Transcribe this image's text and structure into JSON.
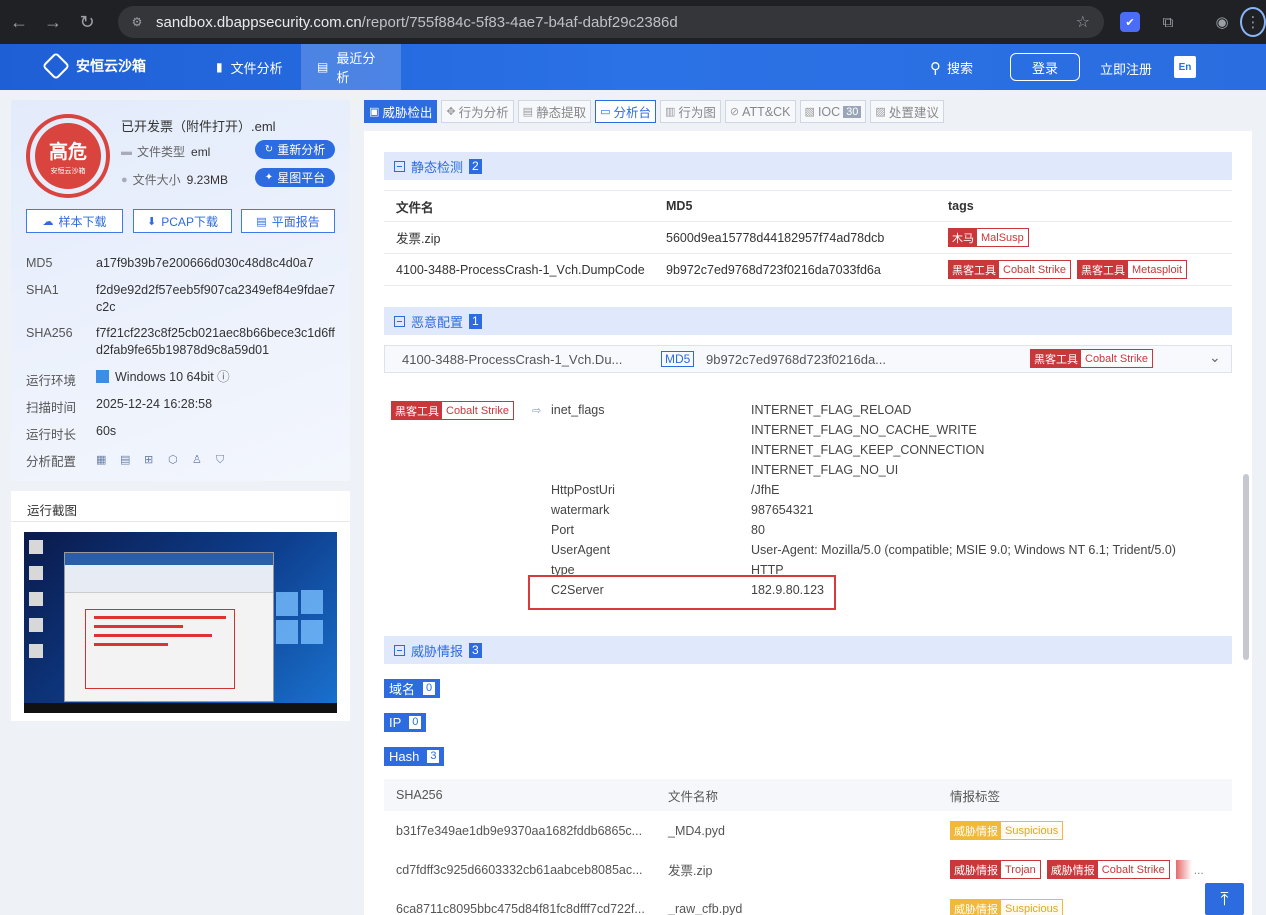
{
  "browser": {
    "url_host": "sandbox.dbappsecurity.com.cn",
    "url_path": "/report/755f884c-5f83-4ae7-b4af-dabf29c2386d"
  },
  "header": {
    "brand": "安恒云沙箱",
    "nav": [
      "文件分析",
      "最近分析"
    ],
    "search": "搜索",
    "login": "登录",
    "register": "立即注册",
    "lang": "En"
  },
  "file": {
    "risk": "高危",
    "seal_sub": "安恒云沙箱",
    "name": "已开发票（附件打开）.eml",
    "type_label": "文件类型",
    "type_value": "eml",
    "size_label": "文件大小",
    "size_value": "9.23MB",
    "reanalyze": "重新分析",
    "xingtu": "星图平台",
    "buttons": [
      "样本下载",
      "PCAP下载",
      "平面报告"
    ],
    "md5_label": "MD5",
    "md5": "a17f9b39b7e200666d030c48d8c4d0a7",
    "sha1_label": "SHA1",
    "sha1": "f2d9e92d2f57eeb5f907ca2349ef84e9fdae7c2c",
    "sha256_label": "SHA256",
    "sha256": "f7f21cf223c8f25cb021aec8b66bece3c1d6ffd2fab9fe65b19878d9c8a59d01",
    "env_label": "运行环境",
    "env": "Windows 10 64bit",
    "scan_label": "扫描时间",
    "scan": "2025-12-24 16:28:58",
    "dur_label": "运行时长",
    "dur": "60s",
    "cfg_label": "分析配置"
  },
  "screenshot": {
    "title": "运行截图"
  },
  "tabs": [
    "威胁检出",
    "行为分析",
    "静态提取",
    "分析台",
    "行为图",
    "ATT&CK",
    "IOC",
    "处置建议"
  ],
  "ioc_count": "30",
  "static": {
    "title": "静态检测",
    "count": "2",
    "columns": [
      "文件名",
      "MD5",
      "tags"
    ],
    "rows": [
      {
        "name": "发票.zip",
        "md5": "5600d9ea15778d44182957f74ad78dcb",
        "tags": [
          {
            "k": "木马",
            "v": "MalSusp"
          }
        ]
      },
      {
        "name": "4100-3488-ProcessCrash-1_Vch.DumpCode",
        "md5": "9b972c7ed9768d723f0216da7033fd6a",
        "tags": [
          {
            "k": "黑客工具",
            "v": "Cobalt Strike"
          },
          {
            "k": "黑客工具",
            "v": "Metasploit"
          }
        ]
      }
    ]
  },
  "malcfg": {
    "title": "恶意配置",
    "count": "1",
    "file": "4100-3488-ProcessCrash-1_Vch.Du...",
    "md5_label": "MD5",
    "md5": "9b972c7ed9768d723f0216da...",
    "tag": {
      "k": "黑客工具",
      "v": "Cobalt Strike"
    },
    "left_tag": {
      "k": "黑客工具",
      "v": "Cobalt Strike"
    },
    "items": [
      {
        "k": "inet_flags",
        "v": "INTERNET_FLAG_RELOAD"
      },
      {
        "k": "",
        "v": "INTERNET_FLAG_NO_CACHE_WRITE"
      },
      {
        "k": "",
        "v": "INTERNET_FLAG_KEEP_CONNECTION"
      },
      {
        "k": "",
        "v": "INTERNET_FLAG_NO_UI"
      },
      {
        "k": "HttpPostUri",
        "v": "/JfhE"
      },
      {
        "k": "watermark",
        "v": "987654321"
      },
      {
        "k": "Port",
        "v": "80"
      },
      {
        "k": "UserAgent",
        "v": "User-Agent: Mozilla/5.0 (compatible; MSIE 9.0; Windows NT 6.1; Trident/5.0)"
      },
      {
        "k": "type",
        "v": "HTTP"
      },
      {
        "k": "C2Server",
        "v": "182.9.80.123"
      }
    ]
  },
  "intel": {
    "title": "威胁情报",
    "count": "3",
    "domain_label": "域名",
    "domain_count": "0",
    "ip_label": "IP",
    "ip_count": "0",
    "hash_label": "Hash",
    "hash_count": "3",
    "columns": [
      "SHA256",
      "文件名称",
      "情报标签"
    ],
    "rows": [
      {
        "sha": "b31f7e349ae1db9e9370aa1682fddb6865c...",
        "name": "_MD4.pyd",
        "tags": [
          {
            "k": "威胁情报",
            "v": "Suspicious",
            "y": true
          }
        ]
      },
      {
        "sha": "cd7fdff3c925d6603332cb61aabceb8085ac...",
        "name": "发票.zip",
        "tags": [
          {
            "k": "威胁情报",
            "v": "Trojan"
          },
          {
            "k": "威胁情报",
            "v": "Cobalt Strike"
          }
        ],
        "more": "..."
      },
      {
        "sha": "6ca8711c8095bbc475d84f81fc8dfff7cd722f...",
        "name": "_raw_cfb.pyd",
        "tags": [
          {
            "k": "威胁情报",
            "v": "Suspicious",
            "y": true
          }
        ]
      }
    ]
  }
}
